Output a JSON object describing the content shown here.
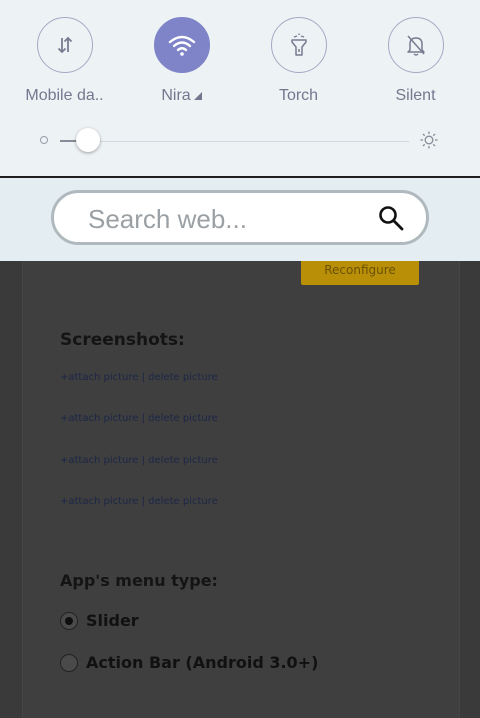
{
  "background_page": {
    "button_label": "Reconfigure",
    "screenshots_heading": "Screenshots:",
    "attach_links": [
      {
        "attach": "+attach picture",
        "sep": " | ",
        "delete": "delete picture"
      },
      {
        "attach": "+attach picture",
        "sep": " | ",
        "delete": "delete picture"
      },
      {
        "attach": "+attach picture",
        "sep": " | ",
        "delete": "delete picture"
      },
      {
        "attach": "+attach picture",
        "sep": " | ",
        "delete": "delete picture"
      }
    ],
    "menu_type_heading": "App's menu type:",
    "menu_options": [
      {
        "label": "Slider",
        "checked": true
      },
      {
        "label": "Action Bar (Android 3.0+)",
        "checked": false
      }
    ]
  },
  "quick_settings": {
    "tiles": [
      {
        "label": "Mobile da..",
        "icon": "mobile-data-icon",
        "active": false
      },
      {
        "label": "Nira",
        "icon": "wifi-icon",
        "active": true
      },
      {
        "label": "Torch",
        "icon": "torch-icon",
        "active": false
      },
      {
        "label": "Silent",
        "icon": "bell-off-icon",
        "active": false
      }
    ],
    "brightness_level": 0.08
  },
  "search": {
    "placeholder": "Search web..."
  },
  "colors": {
    "active_tile": "#7f84c9",
    "panel_bg": "#edf2f5",
    "label": "#76778e"
  }
}
